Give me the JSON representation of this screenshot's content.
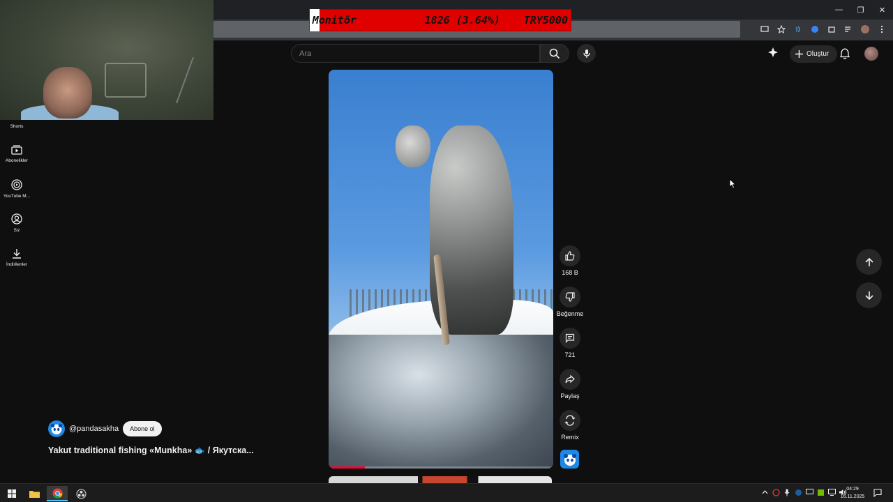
{
  "ticker": {
    "name": "Monitör",
    "change": "1826 (3.64%)",
    "code": "TRY5000"
  },
  "header": {
    "search_placeholder": "Ara",
    "create_label": "Oluştur"
  },
  "sidebar": {
    "items": [
      {
        "label": "Shorts",
        "icon": "shorts-icon"
      },
      {
        "label": "Abonelikler",
        "icon": "subscriptions-icon"
      },
      {
        "label": "YouTube M...",
        "icon": "youtube-music-icon"
      },
      {
        "label": "Siz",
        "icon": "account-icon"
      },
      {
        "label": "İndirilenler",
        "icon": "download-icon"
      }
    ]
  },
  "actions": {
    "like_count": "168 B",
    "dislike_label": "Beğenme",
    "comment_count": "721",
    "share_label": "Paylaş",
    "remix_label": "Remix"
  },
  "channel": {
    "handle": "@pandasakha",
    "subscribe_label": "Abone ol"
  },
  "video": {
    "title": "Yakut traditional fishing «Munkha» 🐟 / Якутска...",
    "progress_fraction": 0.16
  },
  "taskbar": {
    "time": "04:29",
    "date": "16.11.2025"
  },
  "colors": {
    "accent_red": "#ff0033",
    "ticker_bg": "#e00000",
    "background": "#0f0f0f"
  }
}
